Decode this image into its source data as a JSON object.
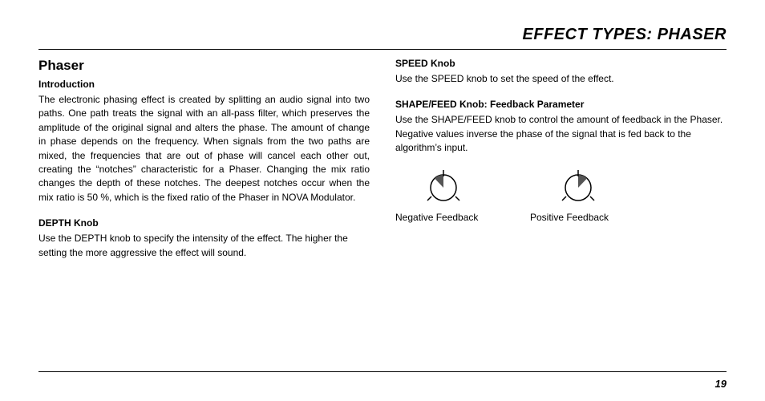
{
  "header": {
    "title": "EFFECT TYPES: PHASER"
  },
  "phaser": {
    "heading": "Phaser",
    "intro": {
      "heading": "Introduction",
      "body": "The electronic phasing effect is created by splitting an audio signal into two paths. One path treats the signal with an all-pass filter, which preserves the amplitude of the original signal and alters the phase. The amount of change in phase depends on the frequency. When signals from the two paths are mixed, the frequencies that are out of phase will cancel each other out, creating the “notches” characteristic for a Phaser. Changing the mix ratio changes the depth of these notches. The deepest notches occur when the mix ratio is 50 %, which is the fixed ratio of the Phaser in NOVA Modulator."
    },
    "depth": {
      "heading": "DEPTH Knob",
      "body": "Use the DEPTH knob to specify the intensity of the effect. The higher the setting the more aggressive the effect will sound."
    },
    "speed": {
      "heading": "SPEED Knob",
      "body": "Use the SPEED knob to set the speed of the effect."
    },
    "feedback": {
      "heading": "SHAPE/FEED Knob: Feedback Parameter",
      "body": "Use the SHAPE/FEED knob to control the amount of feedback in the Phaser. Negative values inverse the phase of the signal that is fed back to the algorithm’s input.",
      "neg_label": "Negative Feedback",
      "pos_label": "Positive Feedback"
    }
  },
  "page_number": "19"
}
